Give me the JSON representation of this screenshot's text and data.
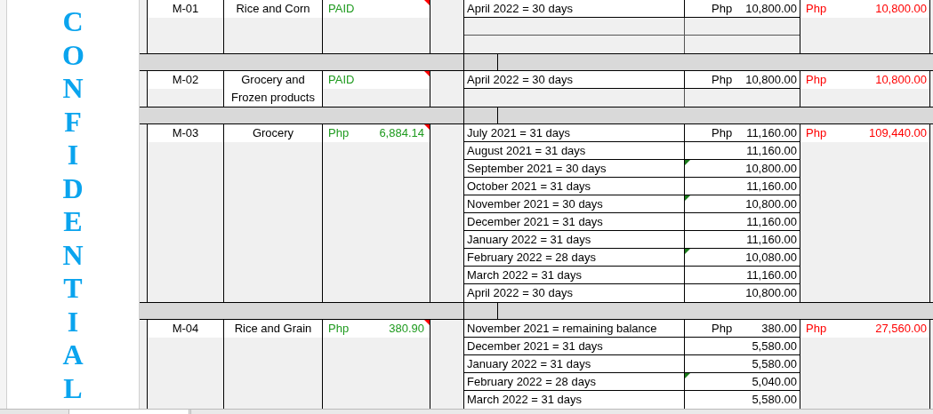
{
  "side_label": "CONFIDENTIAL",
  "groups": [
    {
      "id": "M-01",
      "name": "Rice and Corn",
      "status": {
        "kind": "text",
        "text": "PAID"
      },
      "note": true,
      "rows": [
        {
          "kind": "month",
          "label": "April 2022 = 30 days",
          "currency": "Php",
          "amount": "10,800.00",
          "warning": false
        },
        {
          "kind": "blank"
        },
        {
          "kind": "blank"
        }
      ],
      "total": {
        "currency": "Php",
        "amount": "10,800.00"
      }
    },
    {
      "id": "M-02",
      "name": "Grocery and Frozen products",
      "status": {
        "kind": "text",
        "text": "PAID"
      },
      "note": true,
      "rows": [
        {
          "kind": "month",
          "label": "April 2022 = 30 days",
          "currency": "Php",
          "amount": "10,800.00",
          "warning": false
        },
        {
          "kind": "blank"
        }
      ],
      "total": {
        "currency": "Php",
        "amount": "10,800.00"
      }
    },
    {
      "id": "M-03",
      "name": "Grocery",
      "status": {
        "kind": "amount",
        "currency": "Php",
        "amount": "6,884.14"
      },
      "note": true,
      "rows": [
        {
          "kind": "month",
          "label": "July 2021 = 31 days",
          "currency": "Php",
          "amount": "11,160.00",
          "warning": false
        },
        {
          "kind": "month",
          "label": "August 2021 = 31 days",
          "amount": "11,160.00",
          "warning": false
        },
        {
          "kind": "month",
          "label": "September 2021 = 30 days",
          "amount": "10,800.00",
          "warning": true
        },
        {
          "kind": "month",
          "label": "October 2021 = 31 days",
          "amount": "11,160.00",
          "warning": false
        },
        {
          "kind": "month",
          "label": "November 2021 = 30 days",
          "amount": "10,800.00",
          "warning": true
        },
        {
          "kind": "month",
          "label": "December 2021 = 31 days",
          "amount": "11,160.00",
          "warning": false
        },
        {
          "kind": "month",
          "label": "January  2022 = 31 days",
          "amount": "11,160.00",
          "warning": false
        },
        {
          "kind": "month",
          "label": "February 2022 = 28 days",
          "amount": "10,080.00",
          "warning": true
        },
        {
          "kind": "month",
          "label": "March 2022 = 31 days",
          "amount": "11,160.00",
          "warning": false
        },
        {
          "kind": "month",
          "label": "April 2022 = 30 days",
          "amount": "10,800.00",
          "warning": false
        }
      ],
      "total": {
        "currency": "Php",
        "amount": "109,440.00"
      }
    },
    {
      "id": "M-04",
      "name": "Rice and Grain",
      "status": {
        "kind": "amount",
        "currency": "Php",
        "amount": "380.90"
      },
      "note": true,
      "rows": [
        {
          "kind": "month",
          "label": "November 2021 = remaining balance",
          "currency": "Php",
          "amount": "380.00",
          "warning": false
        },
        {
          "kind": "month",
          "label": "December 2021 = 31 days",
          "amount": "5,580.00",
          "warning": false
        },
        {
          "kind": "month",
          "label": "January 2022 = 31 days",
          "amount": "5,580.00",
          "warning": false
        },
        {
          "kind": "month",
          "label": "February 2022 = 28 days",
          "amount": "5,040.00",
          "warning": true
        },
        {
          "kind": "month",
          "label": "March 2022 = 31 days",
          "amount": "5,580.00",
          "warning": false
        }
      ],
      "total": {
        "currency": "Php",
        "amount": "27,560.00"
      }
    }
  ]
}
